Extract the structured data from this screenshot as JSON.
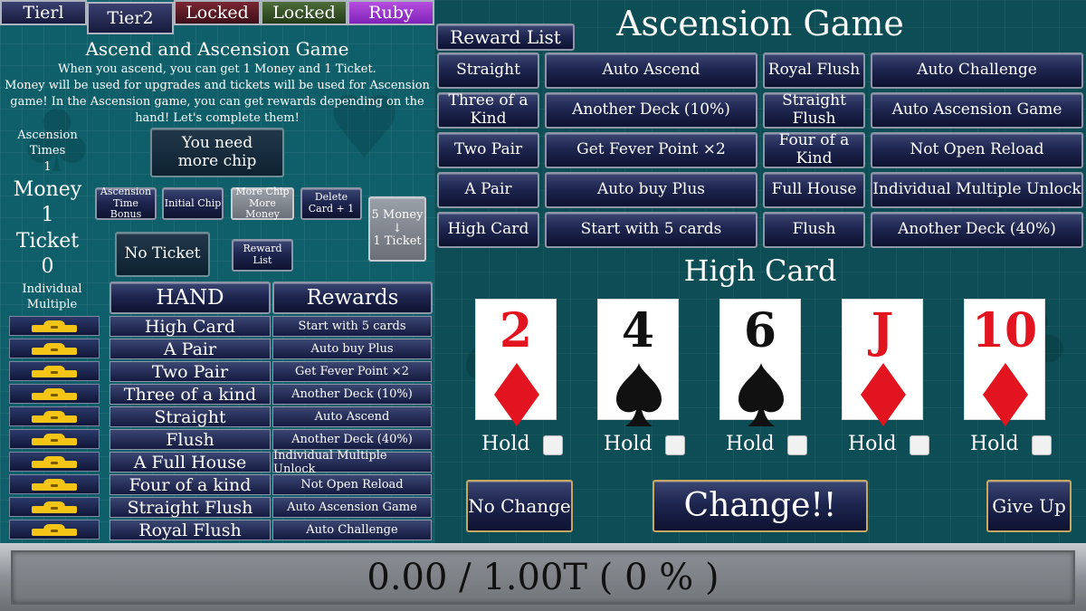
{
  "tabs": [
    "Tierl",
    "Tier2",
    "Locked",
    "Locked",
    "Ruby"
  ],
  "left": {
    "heading": "Ascend and Ascension Game",
    "desc1": "When you ascend, you can get 1 Money and 1 Ticket.",
    "desc2": "Money will be used for upgrades and tickets will be used for Ascension",
    "desc3": "game!  In the Ascension game, you can get rewards depending on the",
    "desc4": "hand!  Let's complete them!",
    "ascension_times_label1": "Ascension",
    "ascension_times_label2": "Times",
    "ascension_times_value": "1",
    "money_label": "Money",
    "money_value": "1",
    "ticket_label": "Ticket",
    "ticket_value": "0",
    "individual_label1": "Individual",
    "individual_label2": "Multiple",
    "need_chip1": "You need",
    "need_chip2": "more chip",
    "btn_ascension_time_bonus1": "Ascension",
    "btn_ascension_time_bonus2": "Time Bonus",
    "btn_initial_chip": "Initial Chip",
    "btn_more_chip1": "More Chip",
    "btn_more_chip2": "More Money",
    "btn_delete_card1": "Delete",
    "btn_delete_card2": "Card + 1",
    "btn_exchange1": "5 Money",
    "btn_exchange_arrow": "↓",
    "btn_exchange2": "1 Ticket",
    "btn_no_ticket": "No Ticket",
    "btn_reward_list1": "Reward",
    "btn_reward_list2": "List",
    "table_header_hand": "HAND",
    "table_header_rewards": "Rewards",
    "rows": [
      {
        "hand": "High Card",
        "reward": "Start with 5 cards"
      },
      {
        "hand": "A Pair",
        "reward": "Auto buy Plus"
      },
      {
        "hand": "Two Pair",
        "reward": "Get Fever Point ×2"
      },
      {
        "hand": "Three of a kind",
        "reward": "Another Deck (10%)"
      },
      {
        "hand": "Straight",
        "reward": "Auto Ascend"
      },
      {
        "hand": "Flush",
        "reward": "Another Deck (40%)"
      },
      {
        "hand": "A Full House",
        "reward": "Individual Multiple Unlock"
      },
      {
        "hand": "Four of a kind",
        "reward": "Not Open Reload"
      },
      {
        "hand": "Straight Flush",
        "reward": "Auto Ascension Game"
      },
      {
        "hand": "Royal Flush",
        "reward": "Auto Challenge"
      }
    ]
  },
  "right": {
    "reward_list_label": "Reward List",
    "title": "Ascension Game",
    "grid": [
      [
        "Straight",
        "Auto Ascend",
        "Royal Flush",
        "Auto Challenge"
      ],
      [
        "Three of a Kind",
        "Another Deck (10%)",
        "Straight Flush",
        "Auto Ascension Game"
      ],
      [
        "Two Pair",
        "Get Fever Point ×2",
        "Four of a Kind",
        "Not Open Reload"
      ],
      [
        "A Pair",
        "Auto buy Plus",
        "Full House",
        "Individual Multiple Unlock"
      ],
      [
        "High Card",
        "Start with 5 cards",
        "Flush",
        "Another Deck (40%)"
      ]
    ],
    "current_hand": "High Card",
    "cards": [
      {
        "rank": "2",
        "suit": "diamond",
        "color": "#e2141f"
      },
      {
        "rank": "4",
        "suit": "spade",
        "color": "#111111"
      },
      {
        "rank": "6",
        "suit": "spade",
        "color": "#111111"
      },
      {
        "rank": "J",
        "suit": "diamond",
        "color": "#e2141f"
      },
      {
        "rank": "10",
        "suit": "diamond",
        "color": "#e2141f"
      }
    ],
    "hold_label": "Hold",
    "btn_no_change": "No Change",
    "btn_change": "Change!!",
    "btn_give_up": "Give Up"
  },
  "progress": {
    "text": "0.00 / 1.00T ( 0 % )",
    "percent": 0
  }
}
